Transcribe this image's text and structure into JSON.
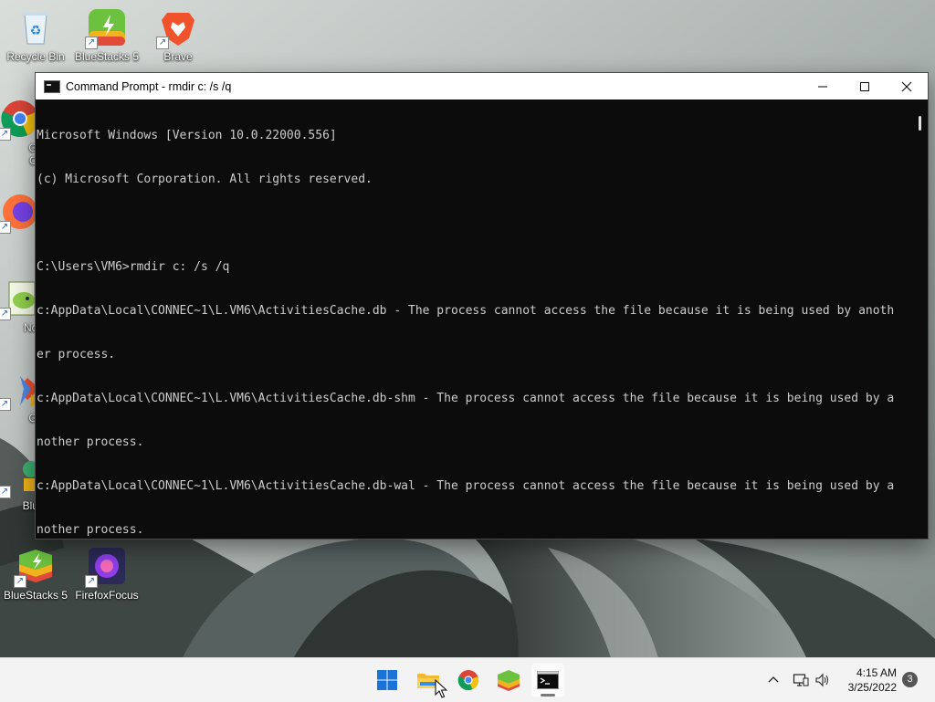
{
  "colors": {
    "console_bg": "#0c0c0c",
    "console_text": "#cccccc",
    "taskbar_bg": "#f3f3f3",
    "titlebar_bg": "#ffffff"
  },
  "desktop": {
    "icons": [
      {
        "label": "Recycle Bin",
        "icon": "recycle-bin-icon"
      },
      {
        "label": "BlueStacks 5 Multi-Instance",
        "icon": "bluestacks-multi-icon"
      },
      {
        "label": "Brave",
        "icon": "brave-icon"
      },
      {
        "label": "Google Chrome",
        "icon": "chrome-icon"
      },
      {
        "label": "Firefox",
        "icon": "firefox-icon"
      },
      {
        "label": "Notepad++",
        "icon": "notepad-plus-icon"
      },
      {
        "label": "Git Bash",
        "icon": "git-bash-icon"
      },
      {
        "label": "BlueStacks X",
        "icon": "bluestacks-x-icon"
      },
      {
        "label": "BlueStacks 5",
        "icon": "bluestacks-icon"
      },
      {
        "label": "FirefoxFocus",
        "icon": "firefox-focus-icon"
      }
    ],
    "visible_labels": {
      "recycle": "Recycle Bin",
      "bluestacks_multi": "BlueStacks 5",
      "brave": "Brave",
      "chrome_1": "Goo",
      "chrome_2": "Chro",
      "firefox": "Fire",
      "notepad": "Notep",
      "git": "Git B",
      "bluestacks_x": "BlueSt",
      "bluestacks5": "BlueStacks 5",
      "firefoxfocus": "FirefoxFocus"
    }
  },
  "window": {
    "title": "Command Prompt - rmdir  c: /s /q",
    "buttons": {
      "minimize": "minimize-icon",
      "maximize": "maximize-icon",
      "close": "close-icon"
    },
    "console_lines": [
      "Microsoft Windows [Version 10.0.22000.556]",
      "(c) Microsoft Corporation. All rights reserved.",
      "",
      "C:\\Users\\VM6>rmdir c: /s /q",
      "c:AppData\\Local\\CONNEC~1\\L.VM6\\ActivitiesCache.db - The process cannot access the file because it is being used by anoth",
      "er process.",
      "c:AppData\\Local\\CONNEC~1\\L.VM6\\ActivitiesCache.db-shm - The process cannot access the file because it is being used by a",
      "nother process.",
      "c:AppData\\Local\\CONNEC~1\\L.VM6\\ActivitiesCache.db-wal - The process cannot access the file because it is being used by a",
      "nother process."
    ]
  },
  "taskbar": {
    "apps": [
      {
        "name": "Start",
        "icon": "windows-start-icon"
      },
      {
        "name": "File Explorer",
        "icon": "file-explorer-icon"
      },
      {
        "name": "Google Chrome",
        "icon": "chrome-icon"
      },
      {
        "name": "BlueStacks",
        "icon": "bluestacks-icon"
      },
      {
        "name": "Command Prompt",
        "icon": "command-prompt-icon",
        "active": true
      }
    ],
    "tray": {
      "chevron": "chevron-up-icon",
      "network": "network-icon",
      "volume": "volume-icon"
    },
    "time": "4:15 AM",
    "date": "3/25/2022",
    "notification_count": "3"
  }
}
